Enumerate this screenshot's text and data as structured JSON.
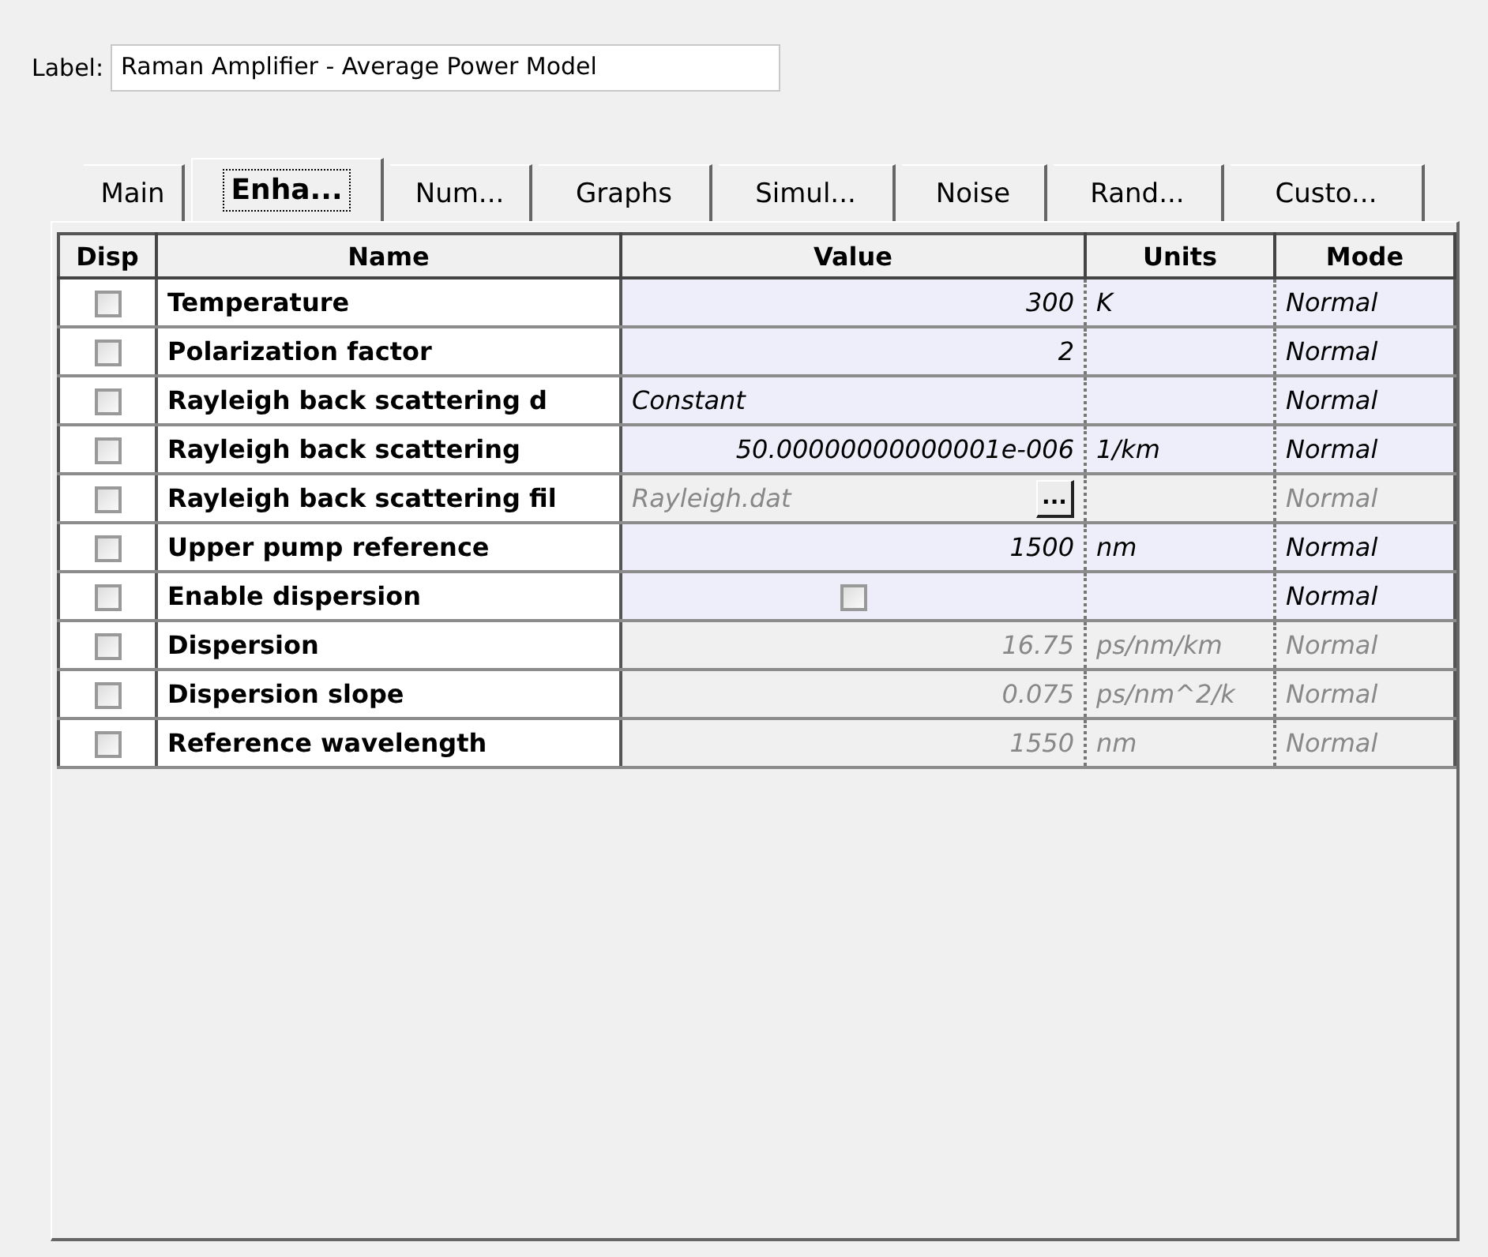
{
  "label": {
    "caption": "Label:",
    "value": "Raman Amplifier - Average Power Model"
  },
  "tabs": [
    {
      "label": "Main",
      "selected": false
    },
    {
      "label": "Enha...",
      "selected": true
    },
    {
      "label": "Num...",
      "selected": false
    },
    {
      "label": "Graphs",
      "selected": false
    },
    {
      "label": "Simul...",
      "selected": false
    },
    {
      "label": "Noise",
      "selected": false
    },
    {
      "label": "Rand...",
      "selected": false
    },
    {
      "label": "Custo...",
      "selected": false
    }
  ],
  "table": {
    "columns": [
      "Disp",
      "Name",
      "Value",
      "Units",
      "Mode"
    ],
    "rows": [
      {
        "disp": false,
        "name": "Temperature",
        "kind": "number",
        "value": "300",
        "units": "K",
        "mode": "Normal",
        "disabled": false
      },
      {
        "disp": false,
        "name": "Polarization factor",
        "kind": "number",
        "value": "2",
        "mode": "Normal",
        "disabled": false
      },
      {
        "disp": false,
        "name": "Rayleigh back scattering d",
        "kind": "text",
        "value": "Constant",
        "mode": "Normal",
        "disabled": false
      },
      {
        "disp": false,
        "name": "Rayleigh back scattering",
        "kind": "number",
        "value": "50.00000000000001e-006",
        "units": "1/km",
        "mode": "Normal",
        "disabled": false
      },
      {
        "disp": false,
        "name": "Rayleigh back scattering fil",
        "kind": "file",
        "value": "Rayleigh.dat",
        "button": "...",
        "mode": "Normal",
        "disabled": true
      },
      {
        "disp": false,
        "name": "Upper pump reference",
        "kind": "number",
        "value": "1500",
        "units": "nm",
        "mode": "Normal",
        "disabled": false
      },
      {
        "disp": false,
        "name": "Enable dispersion",
        "kind": "checkbox",
        "checked": false,
        "mode": "Normal",
        "disabled": false
      },
      {
        "disp": false,
        "name": "Dispersion",
        "kind": "number",
        "value": "16.75",
        "units": "ps/nm/km",
        "mode": "Normal",
        "disabled": true
      },
      {
        "disp": false,
        "name": "Dispersion slope",
        "kind": "number",
        "value": "0.075",
        "units": "ps/nm^2/k",
        "mode": "Normal",
        "disabled": true
      },
      {
        "disp": false,
        "name": "Reference wavelength",
        "kind": "number",
        "value": "1550",
        "units": "nm",
        "mode": "Normal",
        "disabled": true
      }
    ]
  }
}
